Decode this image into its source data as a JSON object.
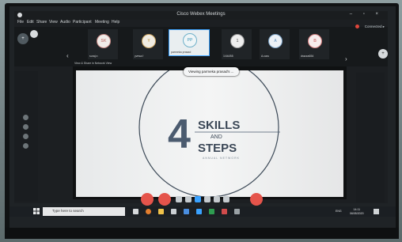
{
  "app": {
    "title": "Cisco Webex Meetings",
    "window_controls": "– ▫ ×",
    "menu": [
      "File",
      "Edit",
      "Share",
      "View",
      "Audio",
      "Participant",
      "Meeting",
      "Help"
    ]
  },
  "participants": [
    {
      "initials": "SK",
      "name": "suraj.n",
      "color": "#c98a86",
      "bg": "#e8eef0"
    },
    {
      "initials": "Y",
      "name": "yvesa.f",
      "color": "#caa35f",
      "bg": "#e8eef0"
    },
    {
      "initials": "PP",
      "name": "parmeka prasad",
      "color": "#6fb0c9",
      "bg": "#e4eef0",
      "active": true
    },
    {
      "initials": "1",
      "name": "1/4t4/55",
      "color": "#8b8b8b",
      "bg": "#e8eef0"
    },
    {
      "initials": "A",
      "name": "A.caru",
      "color": "#7fa6c9",
      "bg": "#e8eef0"
    },
    {
      "initials": "B",
      "name": "drazza654",
      "color": "#d37e7e",
      "bg": "#e8eef0"
    }
  ],
  "status": {
    "connected": "Connected ▸"
  },
  "share": {
    "caption": "View & Share in Network View",
    "viewing": "Viewing parmeka prasad's ..."
  },
  "slide": {
    "numeral": "4",
    "line1": "SKILLS",
    "line2": "AND",
    "line3": "STEPS",
    "tagline": "ANNUAL NETWORK"
  },
  "left_rail": {
    "badge": "+"
  },
  "right_rail": {
    "badge": "+",
    "arrow_left": "‹",
    "arrow_right": "›"
  },
  "controls": {
    "mute_color": "#e5544b",
    "video_color": "#e5544b",
    "leave_color": "#e5544b"
  },
  "taskbar": {
    "search_placeholder": "Type here to search",
    "lang": "ENG",
    "time": "14:11",
    "date": "06/05/2020"
  },
  "colors": {
    "accent": "#3aa2ff",
    "slide_text": "#4b5b6f"
  }
}
